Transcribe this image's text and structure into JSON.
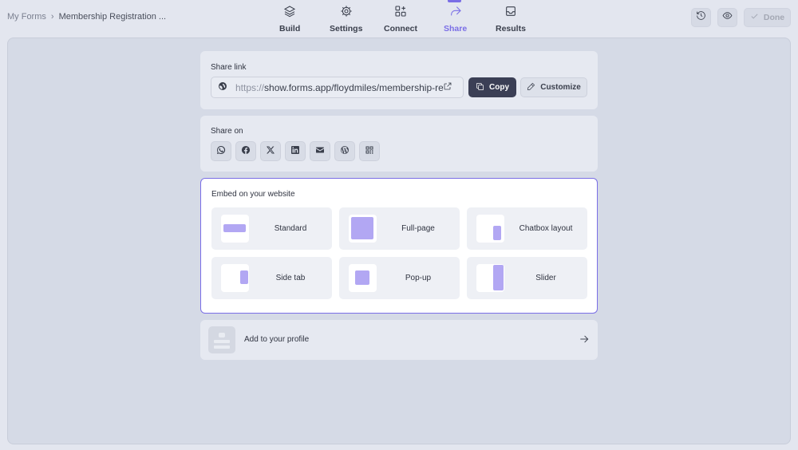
{
  "breadcrumb": {
    "root": "My Forms",
    "separator": "›",
    "current": "Membership Registration ..."
  },
  "nav": [
    {
      "label": "Build",
      "icon": "layers-icon"
    },
    {
      "label": "Settings",
      "icon": "gear-icon"
    },
    {
      "label": "Connect",
      "icon": "connect-icon"
    },
    {
      "label": "Share",
      "icon": "share-arrow-icon",
      "active": true
    },
    {
      "label": "Results",
      "icon": "inbox-icon"
    }
  ],
  "toolbar": {
    "done_label": "Done"
  },
  "share_link": {
    "title": "Share link",
    "url_protocol": "https://",
    "url_rest": "show.forms.app/floydmiles/membership-registration",
    "copy_label": "Copy",
    "customize_label": "Customize"
  },
  "share_on": {
    "title": "Share on",
    "networks": [
      "whatsapp",
      "facebook",
      "x",
      "linkedin",
      "email",
      "wordpress",
      "qr-code"
    ]
  },
  "embed": {
    "title": "Embed on your website",
    "options": [
      {
        "label": "Standard"
      },
      {
        "label": "Full-page"
      },
      {
        "label": "Chatbox layout"
      },
      {
        "label": "Side tab"
      },
      {
        "label": "Pop-up"
      },
      {
        "label": "Slider"
      }
    ]
  },
  "profile": {
    "label": "Add to your profile"
  },
  "colors": {
    "accent": "#7a6ee6",
    "embed_shape": "#b2a7f3",
    "copy_bg": "#3b3f55"
  }
}
